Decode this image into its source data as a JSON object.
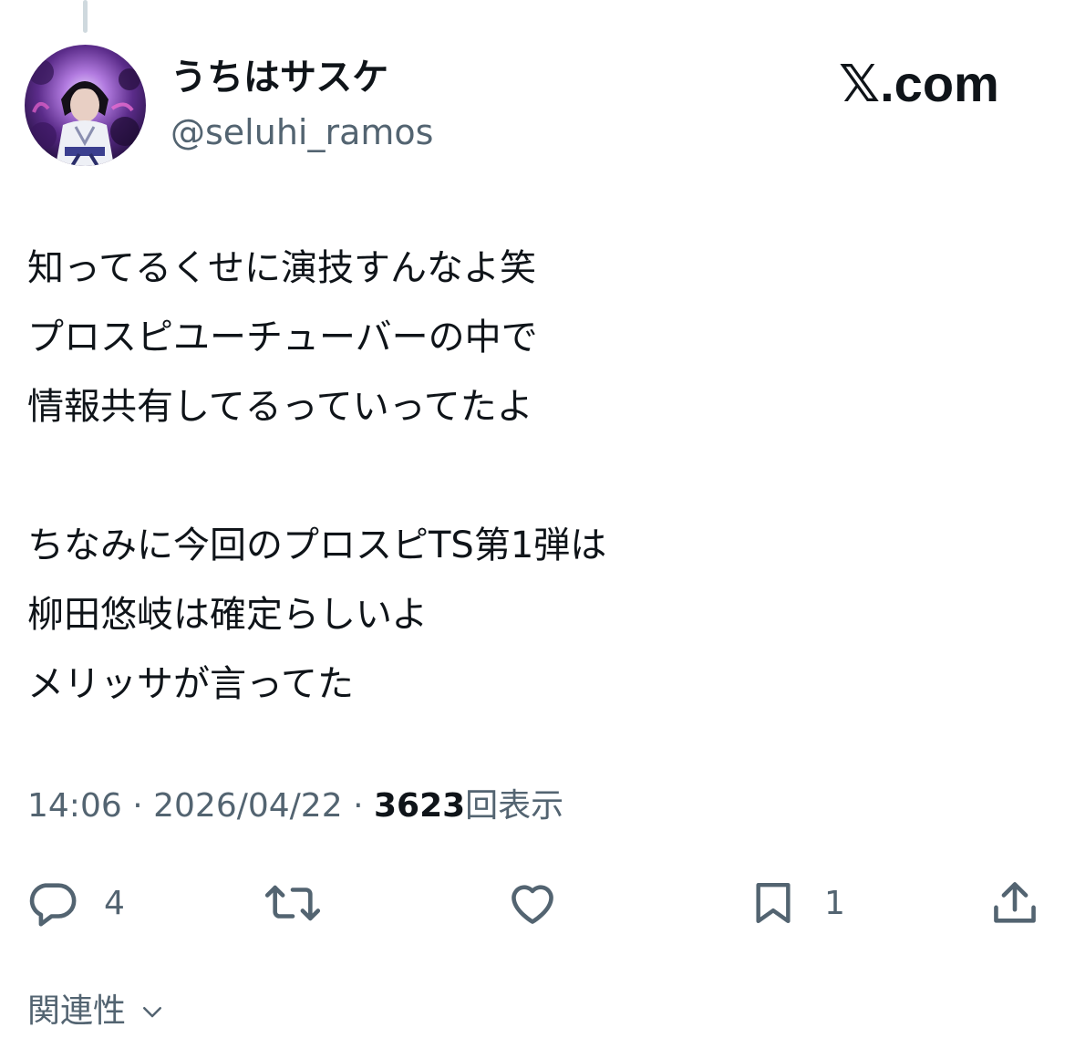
{
  "author": {
    "display_name": "うちはサスケ",
    "handle": "@seluhi_ramos"
  },
  "site": {
    "logo_text": "𝕏.com"
  },
  "tweet": {
    "lines": [
      "知ってるくせに演技すんなよ笑",
      "プロスピユーチューバーの中で",
      "情報共有してるっていってたよ",
      "",
      "ちなみに今回のプロスピTS第1弾は",
      "柳田悠岐は確定らしいよ",
      "メリッサが言ってた"
    ]
  },
  "meta": {
    "time": "14:06",
    "separator": "·",
    "date": "2026/04/22",
    "views_count": "3623",
    "views_label": "回表示"
  },
  "actions": {
    "reply_count": "4",
    "repost_count": "",
    "like_count": "",
    "bookmark_count": "1"
  },
  "related": {
    "label": "関連性"
  },
  "colors": {
    "text_primary": "#0f1419",
    "text_secondary": "#536471",
    "thread_line": "#cfd9de"
  },
  "icons": [
    "reply-icon",
    "repost-icon",
    "like-icon",
    "bookmark-icon",
    "share-icon",
    "chevron-down-icon"
  ]
}
